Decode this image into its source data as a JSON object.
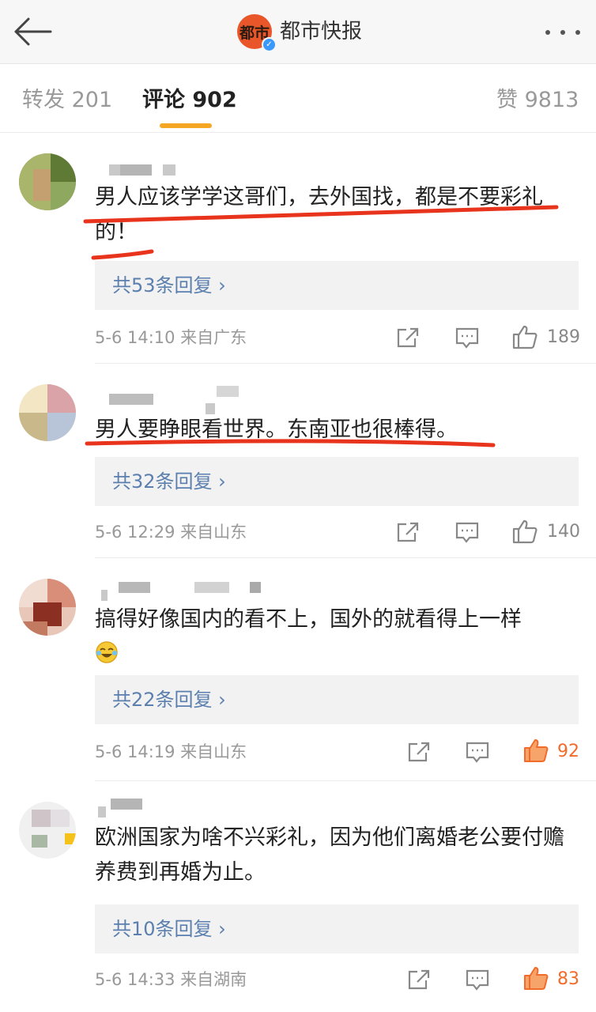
{
  "header": {
    "account_name": "都市快报",
    "logo_text": "都市",
    "verified_mark": "✓"
  },
  "tabs": {
    "repost": "转发 201",
    "comments": "评论 902",
    "likes": "赞 9813"
  },
  "comments": [
    {
      "text": "男人应该学学这哥们，去外国找，都是不要彩礼的！",
      "replies": "共53条回复 ›",
      "time_source": "5-6 14:10  来自广东",
      "likes": "189",
      "liked": false
    },
    {
      "text": "男人要睁眼看世界。东南亚也很棒得。",
      "replies": "共32条回复 ›",
      "time_source": "5-6 12:29  来自山东",
      "likes": "140",
      "liked": false
    },
    {
      "text": "搞得好像国内的看不上，国外的就看得上一样",
      "emoji": "laughing-crying-emoji",
      "replies": "共22条回复 ›",
      "time_source": "5-6 14:19  来自山东",
      "likes": "92",
      "liked": true
    },
    {
      "text": "欧洲国家为啥不兴彩礼，因为他们离婚老公要付赡养费到再婚为止。",
      "replies": "共10条回复 ›",
      "time_source": "5-6 14:33  来自湖南",
      "likes": "83",
      "liked": true
    }
  ],
  "icons": {
    "back": "back-arrow-icon",
    "more": "more-dots-icon",
    "share": "share-icon",
    "comment": "comment-icon",
    "like": "thumbs-up-icon"
  },
  "colors": {
    "accent": "#f5a623",
    "link": "#5b7fae",
    "like_active": "#f26b2b",
    "annotation": "#e8341c"
  }
}
